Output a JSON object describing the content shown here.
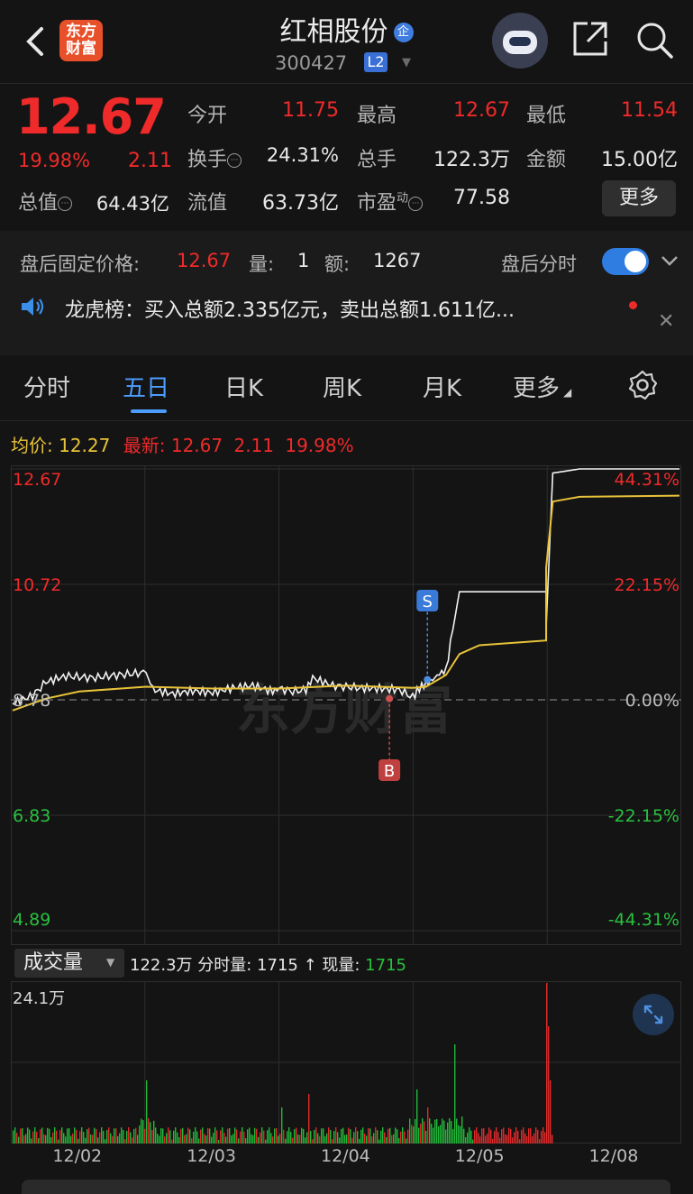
{
  "header": {
    "back_icon": "chevron-left-icon",
    "logo_lines": [
      "东方",
      "财富"
    ],
    "stock_name": "红相股份",
    "enterprise_badge": "企",
    "stock_code": "300427",
    "level_badge": "L2",
    "robot_icon": "robot-avatar-icon",
    "share_icon": "share-icon",
    "search_icon": "search-icon"
  },
  "quote": {
    "price": "12.67",
    "change_pct": "19.98%",
    "change": "2.11",
    "open_label": "今开",
    "open": "11.75",
    "high_label": "最高",
    "high": "12.67",
    "low_label": "最低",
    "low": "11.54",
    "turnover_label": "换手",
    "turnover": "24.31%",
    "volume_label": "总手",
    "volume": "122.3万",
    "amount_label": "金额",
    "amount": "15.00亿",
    "mktcap_label": "总值",
    "mktcap": "64.43亿",
    "float_label": "流值",
    "float": "63.73亿",
    "pe_label": "市盈",
    "pe_sup": "动",
    "pe": "77.58",
    "more_label": "更多"
  },
  "after_hours": {
    "price_label": "盘后固定价格:",
    "price": "12.67",
    "vol_label": "量:",
    "vol": "1",
    "amt_label": "额:",
    "amt": "1267",
    "toggle_label": "盘后分时",
    "toggle_on": true
  },
  "news": {
    "text": "龙虎榜：买入总额2.335亿元，卖出总额1.611亿...",
    "speaker_icon": "speaker-icon",
    "close_icon": "close-icon"
  },
  "tabs": [
    {
      "label": "分时",
      "active": false
    },
    {
      "label": "五日",
      "active": true
    },
    {
      "label": "日K",
      "active": false
    },
    {
      "label": "周K",
      "active": false
    },
    {
      "label": "月K",
      "active": false
    },
    {
      "label": "更多",
      "active": false
    }
  ],
  "settings_icon": "gear-icon",
  "legend": {
    "avg_label": "均价:",
    "avg": "12.27",
    "latest_label": "最新:",
    "latest": "12.67",
    "change": "2.11",
    "pct": "19.98%"
  },
  "chart_data": {
    "type": "line",
    "y_left_ticks": [
      "12.67",
      "10.72",
      "8.78",
      "6.83",
      "4.89"
    ],
    "y_right_ticks": [
      "44.31%",
      "22.15%",
      "0.00%",
      "-22.15%",
      "-44.31%"
    ],
    "ylim": [
      4.89,
      12.67
    ],
    "baseline": 8.78,
    "x_labels": [
      "12/02",
      "12/03",
      "12/04",
      "12/05",
      "12/08"
    ],
    "series": [
      {
        "name": "price",
        "color": "#f2f2f2"
      },
      {
        "name": "avg",
        "color": "#e8c33a"
      }
    ],
    "price_points": [
      [
        0.0,
        8.72
      ],
      [
        0.03,
        8.85
      ],
      [
        0.05,
        9.08
      ],
      [
        0.08,
        9.18
      ],
      [
        0.12,
        9.15
      ],
      [
        0.16,
        9.2
      ],
      [
        0.2,
        9.24
      ],
      [
        0.21,
        8.95
      ],
      [
        0.24,
        8.88
      ],
      [
        0.27,
        8.93
      ],
      [
        0.3,
        8.9
      ],
      [
        0.33,
        8.98
      ],
      [
        0.36,
        9.02
      ],
      [
        0.39,
        8.92
      ],
      [
        0.4,
        8.97
      ],
      [
        0.42,
        8.92
      ],
      [
        0.44,
        8.95
      ],
      [
        0.45,
        9.15
      ],
      [
        0.48,
        9.02
      ],
      [
        0.52,
        8.98
      ],
      [
        0.55,
        8.97
      ],
      [
        0.58,
        8.95
      ],
      [
        0.6,
        8.82
      ],
      [
        0.61,
        8.98
      ],
      [
        0.62,
        9.05
      ],
      [
        0.63,
        9.12
      ],
      [
        0.64,
        9.22
      ],
      [
        0.65,
        9.28
      ],
      [
        0.66,
        9.95
      ],
      [
        0.67,
        10.6
      ],
      [
        0.7,
        10.6
      ],
      [
        0.8,
        10.6
      ],
      [
        0.8,
        10.0
      ],
      [
        0.81,
        12.6
      ],
      [
        0.85,
        12.67
      ],
      [
        1.0,
        12.67
      ]
    ],
    "avg_points": [
      [
        0.0,
        8.6
      ],
      [
        0.05,
        8.8
      ],
      [
        0.1,
        8.92
      ],
      [
        0.2,
        9.0
      ],
      [
        0.3,
        8.97
      ],
      [
        0.4,
        8.97
      ],
      [
        0.5,
        9.02
      ],
      [
        0.6,
        8.98
      ],
      [
        0.62,
        9.0
      ],
      [
        0.65,
        9.2
      ],
      [
        0.67,
        9.55
      ],
      [
        0.7,
        9.7
      ],
      [
        0.8,
        9.78
      ],
      [
        0.8,
        11.0
      ],
      [
        0.81,
        12.12
      ],
      [
        0.85,
        12.2
      ],
      [
        1.0,
        12.22
      ]
    ],
    "signals": [
      {
        "label": "S",
        "color": "#3a7ad8"
      },
      {
        "label": "B",
        "color": "#c04040"
      }
    ],
    "watermark": "东方财富"
  },
  "volume": {
    "selector": "成交量",
    "summary": "122.3万 分时量: 1715 ↑ 现量:",
    "current": "1715",
    "max_label": "24.1万",
    "expand_icon": "expand-icon"
  }
}
